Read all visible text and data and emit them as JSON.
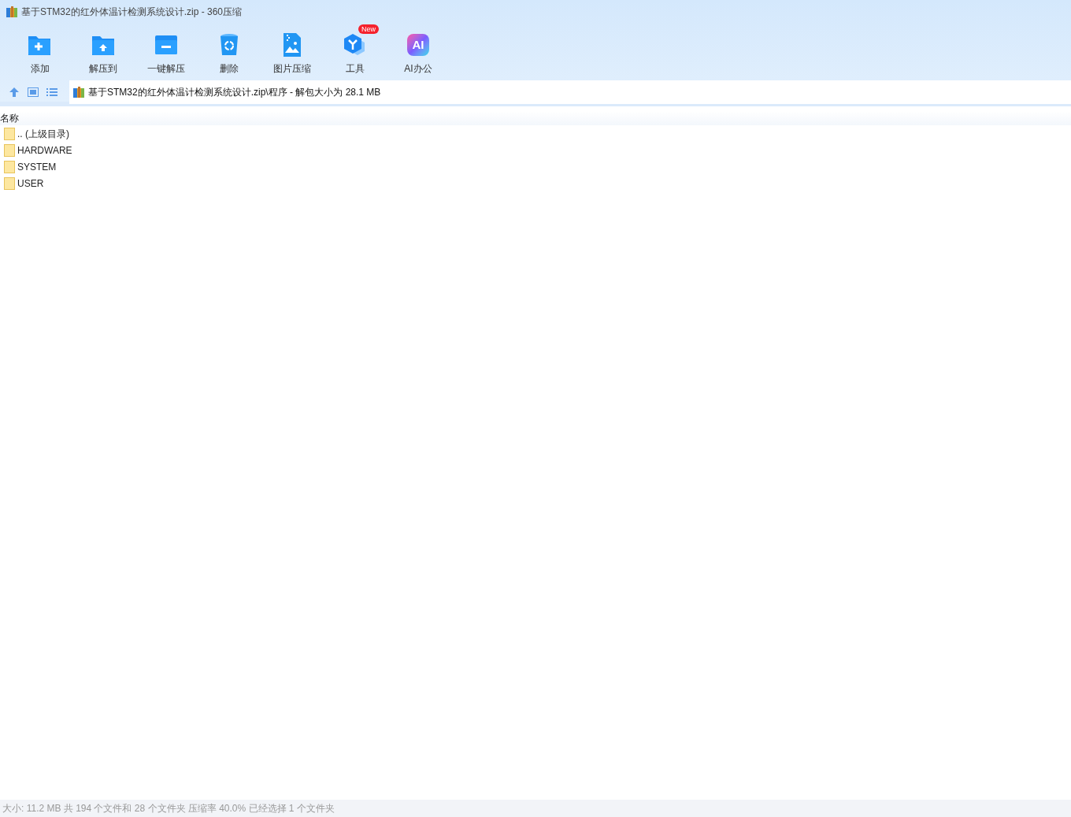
{
  "window": {
    "title": "基于STM32的红外体温计检测系统设计.zip - 360压缩"
  },
  "toolbar": [
    {
      "kind": "add",
      "label": "添加"
    },
    {
      "kind": "extract_to",
      "label": "解压到"
    },
    {
      "kind": "quick_extract",
      "label": "一键解压"
    },
    {
      "kind": "delete",
      "label": "删除"
    },
    {
      "kind": "image",
      "label": "图片压缩"
    },
    {
      "kind": "tools",
      "label": "工具",
      "badge": "New"
    },
    {
      "kind": "ai",
      "label": "AI办公",
      "icon_text": "AI"
    }
  ],
  "address_bar": {
    "path": "基于STM32的红外体温计检测系统设计.zip\\程序 - 解包大小为 28.1 MB"
  },
  "file_list": {
    "columns": [
      "名称"
    ],
    "rows": [
      {
        "name": ".. (上级目录)"
      },
      {
        "name": "HARDWARE"
      },
      {
        "name": "SYSTEM"
      },
      {
        "name": "USER"
      }
    ]
  },
  "status_bar": "大小: 11.2 MB 共 194 个文件和 28 个文件夹 压缩率 40.0% 已经选择 1 个文件夹"
}
